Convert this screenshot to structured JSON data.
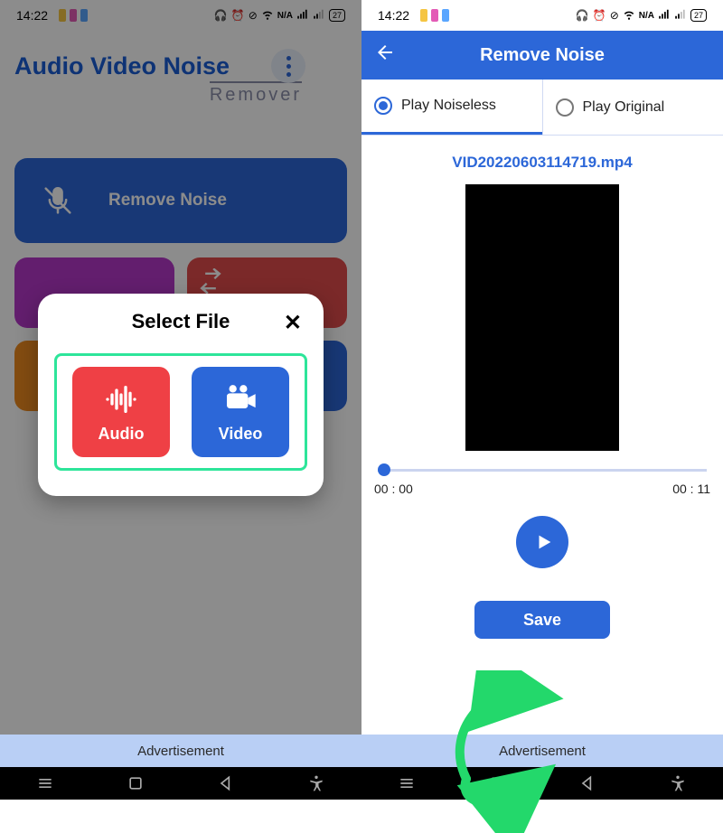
{
  "statusbar": {
    "time": "14:22",
    "battery": "27"
  },
  "left": {
    "title_main": "Audio Video Noise",
    "title_sub": "Remover",
    "remove_label": "Remove Noise",
    "modal": {
      "title": "Select File",
      "audio_label": "Audio",
      "video_label": "Video"
    },
    "ad": "Advertisement"
  },
  "right": {
    "appbar_title": "Remove Noise",
    "tab_noiseless": "Play Noiseless",
    "tab_original": "Play Original",
    "filename": "VID20220603114719.mp4",
    "time_start": "00 : 00",
    "time_end": "00 : 11",
    "save_label": "Save",
    "ad": "Advertisement"
  }
}
